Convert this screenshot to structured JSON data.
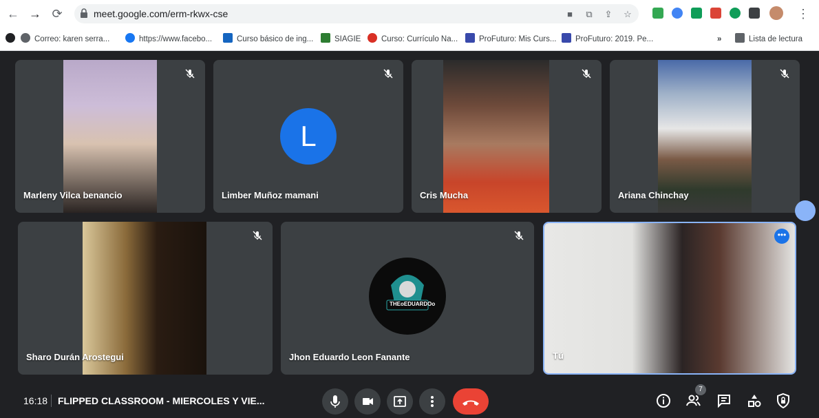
{
  "browser": {
    "url": "meet.google.com/erm-rkwx-cse",
    "bookmarks": [
      {
        "label": "Correo: karen serra...",
        "color": "#5f6368"
      },
      {
        "label": "https://www.facebo...",
        "color": "#1877f2"
      },
      {
        "label": "Curso básico de ing...",
        "color": "#1565c0"
      },
      {
        "label": "SIAGIE",
        "color": "#2e7d32"
      },
      {
        "label": "Curso: Currículo Na...",
        "color": "#d93025"
      },
      {
        "label": "ProFuturo: Mis Curs...",
        "color": "#3949ab"
      },
      {
        "label": "ProFuturo: 2019. Pe...",
        "color": "#3949ab"
      }
    ],
    "overflow": "»",
    "reading_list": "Lista de lectura"
  },
  "participants": [
    {
      "name": "Marleny Vilca benancio"
    },
    {
      "name": "Limber Muñoz mamani",
      "initial": "L"
    },
    {
      "name": "Cris Mucha"
    },
    {
      "name": "Ariana Chinchay"
    },
    {
      "name": "Sharo Durán Arostegui"
    },
    {
      "name": "Jhon Eduardo Leon Fanante",
      "logo_text": "THEoEDUARDOo"
    },
    {
      "name": "Tú"
    }
  ],
  "meeting": {
    "time": "16:18",
    "title": "FLIPPED CLASSROOM - MIERCOLES Y VIE...",
    "participant_count": "7"
  },
  "colors": {
    "background": "#202124",
    "tile": "#3c4043",
    "accent": "#1a73e8",
    "hangup": "#ea4335"
  }
}
